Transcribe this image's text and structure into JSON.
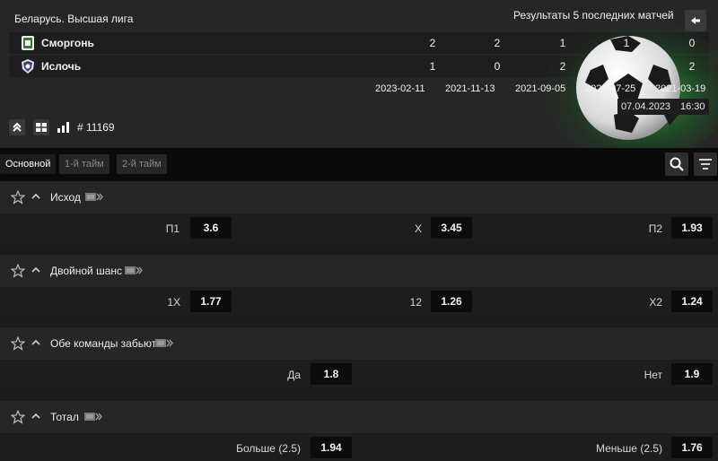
{
  "header": {
    "league": "Беларусь. Высшая лига",
    "results_title": "Результаты 5 последних матчей",
    "teams": [
      {
        "name": "Сморгонь",
        "scores": [
          "2",
          "2",
          "1",
          "1",
          "0"
        ]
      },
      {
        "name": "Ислочь",
        "scores": [
          "1",
          "0",
          "2",
          "2",
          "2"
        ]
      }
    ],
    "dates": [
      "2023-02-11",
      "2021-11-13",
      "2021-09-05",
      "2021-07-25",
      "2021-03-19"
    ],
    "match_date": "07.04.2023",
    "match_time": "16:30",
    "event_id": "# 11169"
  },
  "tabs": [
    "Основной",
    "1-й тайм",
    "2-й тайм"
  ],
  "active_tab": 0,
  "markets": [
    {
      "title": "Исход",
      "bets": [
        {
          "label": "П1",
          "odd": "3.6"
        },
        {
          "label": "X",
          "odd": "3.45"
        },
        {
          "label": "П2",
          "odd": "1.93"
        }
      ]
    },
    {
      "title": "Двойной шанс",
      "bets": [
        {
          "label": "1X",
          "odd": "1.77"
        },
        {
          "label": "12",
          "odd": "1.26"
        },
        {
          "label": "X2",
          "odd": "1.24"
        }
      ]
    },
    {
      "title": "Обе команды забьют",
      "bets": [
        {
          "label": "Да",
          "odd": "1.8"
        },
        {
          "label": "Нет",
          "odd": "1.9"
        }
      ]
    },
    {
      "title": "Тотал",
      "bets": [
        {
          "label": "Больше (2.5)",
          "odd": "1.94"
        },
        {
          "label": "Меньше (2.5)",
          "odd": "1.76"
        }
      ]
    }
  ],
  "colors": {
    "background": "#1b1b1b",
    "panel": "#262626",
    "odd_box": "#0c0c0c",
    "accent_green": "#2f8f3a"
  }
}
